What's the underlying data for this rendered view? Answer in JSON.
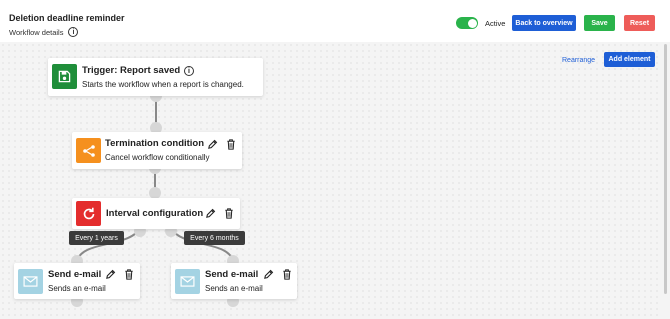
{
  "header": {
    "title": "Deletion deadline reminder",
    "subtitle": "Workflow details",
    "active_label": "Active",
    "active_on": true,
    "back_label": "Back to overview",
    "save_label": "Save",
    "reset_label": "Reset"
  },
  "canvas": {
    "rearrange_label": "Rearrange",
    "add_element_label": "Add element"
  },
  "nodes": {
    "trigger": {
      "title": "Trigger: Report saved",
      "description": "Starts the workflow when a report is changed.",
      "icon": "save-icon",
      "color": "#1f8e3a"
    },
    "termination": {
      "title": "Termination condition",
      "description": "Cancel workflow conditionally",
      "icon": "branch-icon",
      "color": "#f5901e"
    },
    "interval": {
      "title": "Interval configuration",
      "icon": "refresh-icon",
      "color": "#e42d2d"
    },
    "email_left": {
      "title": "Send e-mail",
      "description": "Sends an e-mail",
      "icon": "mail-icon",
      "color": "#a4d3e3"
    },
    "email_right": {
      "title": "Send e-mail",
      "description": "Sends an e-mail",
      "icon": "mail-icon",
      "color": "#a4d3e3"
    }
  },
  "edges": {
    "left_label": "Every 1 years",
    "right_label": "Every 6 months"
  }
}
